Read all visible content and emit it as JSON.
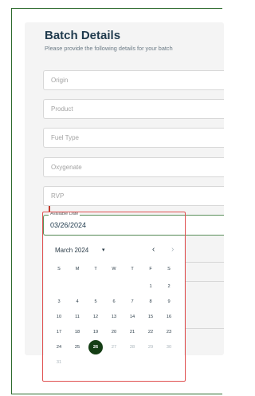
{
  "header": {
    "title": "Batch Details",
    "subtitle": "Please provide the following details for your batch"
  },
  "fields": [
    {
      "label": "Origin"
    },
    {
      "label": "Product"
    },
    {
      "label": "Fuel Type"
    },
    {
      "label": "Oxygenate"
    },
    {
      "label": "RVP"
    }
  ],
  "date_field": {
    "label": "Available Date",
    "value": "03/26/2024"
  },
  "calendar": {
    "month_label": "March 2024",
    "caret": "▾",
    "prev_icon": "‹",
    "next_icon": "›",
    "weekdays": [
      "S",
      "M",
      "T",
      "W",
      "T",
      "F",
      "S"
    ],
    "days": [
      "1",
      "2",
      "3",
      "4",
      "5",
      "6",
      "7",
      "8",
      "9",
      "10",
      "11",
      "12",
      "13",
      "14",
      "15",
      "16",
      "17",
      "18",
      "19",
      "20",
      "21",
      "22",
      "23",
      "24",
      "25",
      "26",
      "27",
      "28",
      "29",
      "30",
      "31"
    ],
    "first_weekday_index": 5,
    "selected_day": "26",
    "last_enabled_day": 26,
    "colors": {
      "selected_bg": "#143d14",
      "highlight_border": "#e05252",
      "frame_border": "#2e6b2e"
    }
  }
}
